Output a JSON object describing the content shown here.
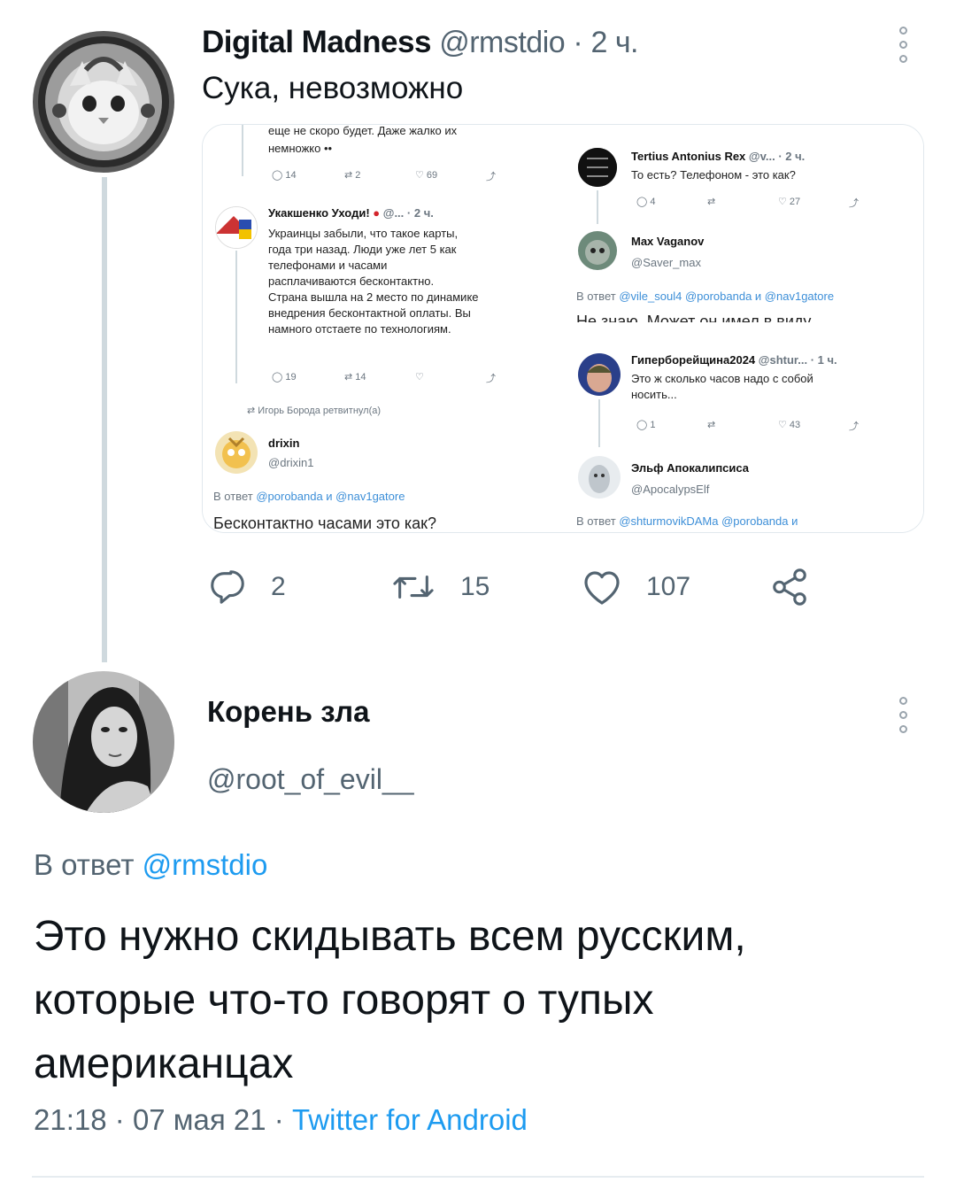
{
  "tweet1": {
    "author_name": "Digital Madness",
    "handle": "@rmstdio",
    "time": "2 ч.",
    "sep": "·",
    "text": "Сука, невозможно",
    "stats": {
      "replies": "2",
      "retweets": "15",
      "likes": "107"
    }
  },
  "left_screenshot": {
    "top_text_1": "еще не скоро будет. Даже жалко их",
    "top_text_2": "немножко ••",
    "top_stats": [
      "14",
      "2",
      "69"
    ],
    "reply1": {
      "name": "Укакшенко Уходи!",
      "handle": "@...",
      "time": "· 2 ч.",
      "lines": [
        "Украинцы забыли, что такое карты,",
        "года три назад. Люди уже лет 5 как",
        "телефонами и часами",
        "расплачиваются бесконтактно.",
        "Страна вышла на 2 место по динамике",
        "внедрения бесконтактной оплаты. Вы",
        "намного отстаете по технологиям."
      ],
      "stats": [
        "19",
        "14"
      ]
    },
    "retweeted_by": "Игорь Борода ретвитнул(а)",
    "reply2": {
      "name": "drixin",
      "handle": "@drixin1",
      "in_reply_prefix": "В ответ",
      "in_reply_users": "@porobanda и @nav1gatore",
      "text": "Бесконтактно часами это как?"
    }
  },
  "right_top_screenshot": {
    "reply1": {
      "name": "Tertius Antonius Rex",
      "handle": "@v...",
      "time": "· 2 ч.",
      "text": "То есть? Телефоном - это как?",
      "stats": [
        "4",
        "27"
      ]
    },
    "reply2": {
      "name": "Max Vaganov",
      "handle": "@Saver_max",
      "in_reply_prefix": "В ответ",
      "in_reply_users": "@vile_soul4 @porobanda и @nav1gatore",
      "text": "Не знаю. Может он имел в виду"
    }
  },
  "right_bottom_screenshot": {
    "reply1": {
      "name": "Гиперборейщина2024",
      "handle": "@shtur...",
      "time": "· 1 ч.",
      "lines": [
        "Это ж сколько часов надо с собой",
        "носить..."
      ],
      "stats": [
        "1",
        "43"
      ]
    },
    "reply2": {
      "name": "Эльф Апокалипсиса",
      "handle": "@ApocalypsElf",
      "in_reply_prefix": "В ответ",
      "in_reply_users": "@shturmovikDAMa @porobanda и"
    }
  },
  "tweet2": {
    "author_name": "Корень зла",
    "handle": "@root_of_evil__",
    "reply_prefix": "В ответ",
    "reply_to": "@rmstdio",
    "text": "Это нужно скидывать всем русским,\nкоторые что-то говорят о тупых\nамериканцах",
    "time": "21:18",
    "sep1": "·",
    "date": "07 мая 21",
    "sep2": "·",
    "client": "Twitter for Android"
  },
  "colors": {
    "link": "#1d9bf0",
    "secondary": "#536471",
    "text": "#0f1419",
    "thread_line": "#cfd9de"
  },
  "icons": [
    "more-vertical-icon",
    "reply-icon",
    "retweet-icon",
    "like-icon",
    "share-icon"
  ]
}
